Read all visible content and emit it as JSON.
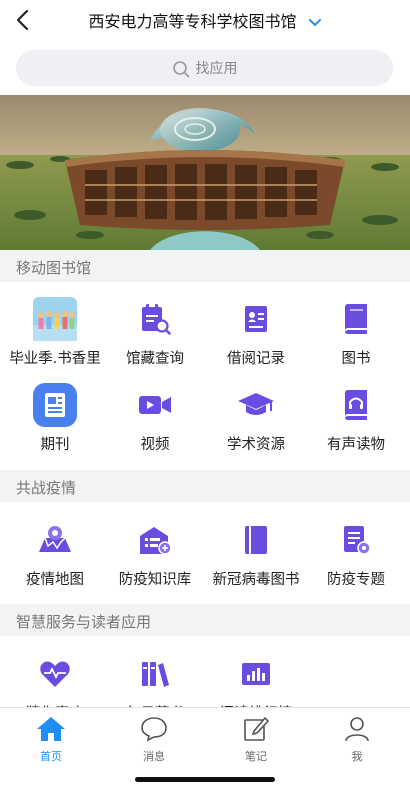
{
  "header": {
    "title": "西安电力高等专科学校图书馆"
  },
  "search": {
    "placeholder": "找应用"
  },
  "sections": [
    {
      "title": "移动图书馆",
      "items": [
        {
          "label": "毕业季.书香里",
          "icon": "graduation-photo-icon"
        },
        {
          "label": "馆藏查询",
          "icon": "catalog-search-icon"
        },
        {
          "label": "借阅记录",
          "icon": "borrow-record-icon"
        },
        {
          "label": "图书",
          "icon": "book-icon"
        },
        {
          "label": "期刊",
          "icon": "journal-icon"
        },
        {
          "label": "视频",
          "icon": "video-icon"
        },
        {
          "label": "学术资源",
          "icon": "mortarboard-icon"
        },
        {
          "label": "有声读物",
          "icon": "audiobook-icon"
        }
      ]
    },
    {
      "title": "共战疫情",
      "items": [
        {
          "label": "疫情地图",
          "icon": "epidemic-map-icon"
        },
        {
          "label": "防疫知识库",
          "icon": "knowledge-base-icon"
        },
        {
          "label": "新冠病毒图书",
          "icon": "covid-book-icon"
        },
        {
          "label": "防疫专题",
          "icon": "topic-doc-icon"
        }
      ]
    },
    {
      "title": "智慧服务与读者应用",
      "items": [
        {
          "label": "猜你喜欢",
          "icon": "heart-pulse-icon"
        },
        {
          "label": "每日荐书",
          "icon": "bookshelf-icon"
        },
        {
          "label": "阅读排行榜",
          "icon": "ranking-chart-icon"
        }
      ]
    }
  ],
  "tabs": [
    {
      "label": "首页",
      "icon": "home-icon",
      "active": true
    },
    {
      "label": "消息",
      "icon": "message-icon",
      "active": false
    },
    {
      "label": "笔记",
      "icon": "note-icon",
      "active": false
    },
    {
      "label": "我",
      "icon": "person-icon",
      "active": false
    }
  ],
  "colors": {
    "accent": "#1f8ff5",
    "icon_purple": "#6a4de0",
    "section_bg": "#f2f3f5"
  }
}
